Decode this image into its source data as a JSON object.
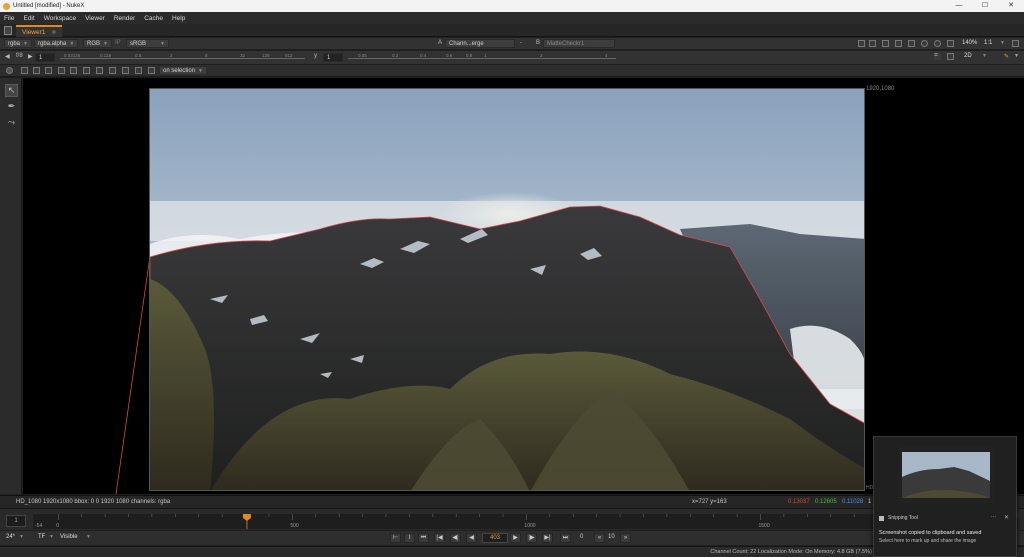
{
  "window": {
    "title": "Untitled [modified] - NukeX",
    "minimize_glyph": "—",
    "maximize_glyph": "☐",
    "close_glyph": "✕"
  },
  "menu": [
    "File",
    "Edit",
    "Workspace",
    "Viewer",
    "Render",
    "Cache",
    "Help"
  ],
  "viewer_tab": {
    "label": "Viewer1",
    "close_glyph": "⊗"
  },
  "toolbar1": {
    "layer": "rgba",
    "channel": "rgba.alpha",
    "display": "RGB",
    "ip_label": "IP",
    "colorspace": "sRGB",
    "input_a_label": "A",
    "input_a": "Chann...erge",
    "dash": "-",
    "input_b_label": "B",
    "input_b": "MatteCheckr1",
    "zoom": "140%",
    "ratio": "1:1"
  },
  "toolbar2": {
    "fstop": "f/8",
    "gain_value": "1",
    "gamma_label": "y",
    "gamma_value": "1",
    "gain_ticks": [
      "0.03125",
      "0.125",
      "0.5",
      "2",
      "8",
      "32",
      "128",
      "512"
    ],
    "gamma_ticks": [
      "0.05",
      "0.2",
      "0.4",
      "0.6",
      "0.8",
      "1",
      "2",
      "4"
    ],
    "view_mode": "2D"
  },
  "toolbar3": {
    "mode": "on selection"
  },
  "viewer": {
    "format_label": "1920,1080",
    "hd_label": "HD"
  },
  "infobar": {
    "format": "HD_1080 1920x1080  bbox: 0 0 1920 1080 channels: rgba",
    "coords": "x=727 y=163",
    "r": "0.13037",
    "g": "0.12605",
    "b": "0.11028",
    "a": "1"
  },
  "timeline": {
    "frame_box": "1",
    "in_label": "-54",
    "ticks": [
      {
        "label": "0",
        "frame": 0
      },
      {
        "label": "500",
        "frame": 500
      },
      {
        "label": "1000",
        "frame": 1000
      },
      {
        "label": "1500",
        "frame": 1500
      }
    ],
    "range": [
      -54,
      2050
    ],
    "current_frame": 403
  },
  "playback": {
    "fps": "24*",
    "tf": "TF",
    "visible": "Visible",
    "current_frame": "403",
    "increment": "10",
    "zero": "0"
  },
  "status": {
    "text": "Channel Count: 22  Localization Mode: On  Memory: 4.8 GB (7.5%)  CPU: 0.0%  Disk: 0.9 MB/s  Network: 0.0 MB/s",
    "memory_fraction": 0.075
  },
  "toast": {
    "app": "Snipping Tool",
    "message": "Screenshot copied to clipboard and saved",
    "hint": "Select here to mark up and share the image",
    "dots": "...",
    "close": "✕"
  },
  "colors": {
    "accent_orange": "#e08a1e",
    "red_channel": "#e04040",
    "green_channel": "#40c040",
    "blue_channel": "#4a8ae8",
    "roto_outline": "#d84848"
  }
}
